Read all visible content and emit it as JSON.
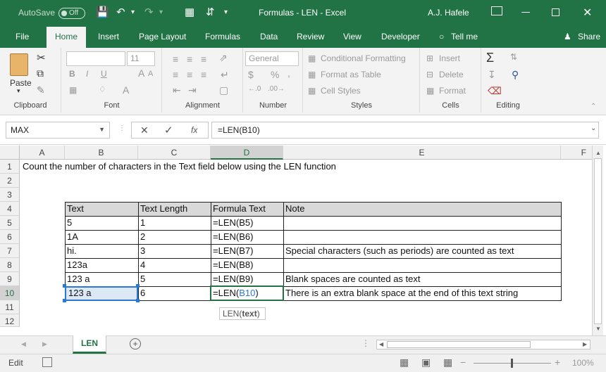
{
  "title_bar": {
    "autosave_label": "AutoSave",
    "autosave_state": "Off",
    "doc_title": "Formulas - LEN  -  Excel",
    "user": "A.J. Hafele"
  },
  "tabs": [
    "File",
    "Home",
    "Insert",
    "Page Layout",
    "Formulas",
    "Data",
    "Review",
    "View",
    "Developer",
    "Tell me",
    "Share"
  ],
  "ribbon": {
    "clipboard": {
      "paste": "Paste",
      "label": "Clipboard"
    },
    "font": {
      "size": "11",
      "bold": "B",
      "italic": "I",
      "underline": "U",
      "label": "Font"
    },
    "alignment": {
      "label": "Alignment"
    },
    "number": {
      "format": "General",
      "currency": "$",
      "percent": "%",
      "comma": ",",
      "label": "Number"
    },
    "styles": {
      "conditional": "Conditional Formatting",
      "table": "Format as Table",
      "cell": "Cell Styles",
      "label": "Styles"
    },
    "cells": {
      "insert": "Insert",
      "delete": "Delete",
      "format": "Format",
      "label": "Cells"
    },
    "editing": {
      "label": "Editing"
    }
  },
  "formula_bar": {
    "name_box": "MAX",
    "fx": "fx",
    "formula": "=LEN(B10)"
  },
  "columns": [
    "A",
    "B",
    "C",
    "D",
    "E",
    "F"
  ],
  "rows": [
    "1",
    "2",
    "3",
    "4",
    "5",
    "6",
    "7",
    "8",
    "9",
    "10",
    "11",
    "12"
  ],
  "cells": {
    "a1": "Count the number of characters in the Text field below using the LEN function",
    "headers": [
      "Text",
      "Text Length",
      "Formula Text",
      "Note"
    ],
    "table": [
      [
        "5",
        "1",
        "=LEN(B5)",
        ""
      ],
      [
        "1A",
        "2",
        "=LEN(B6)",
        ""
      ],
      [
        "hi.",
        "3",
        "=LEN(B7)",
        "Special characters (such as periods) are counted as text"
      ],
      [
        "123a",
        "4",
        "=LEN(B8)",
        ""
      ],
      [
        "123 a",
        "5",
        "=LEN(B9)",
        "Blank spaces are counted as text"
      ],
      [
        "123 a",
        "6",
        "=LEN(",
        "There is an extra blank space at the end of this text string"
      ]
    ],
    "edit_ref": "B10",
    "edit_close": ")"
  },
  "tooltip": {
    "fn": "LEN(",
    "arg": "text",
    ")": ")"
  },
  "tooltip_text": "LEN(text)",
  "sheet_tab": "LEN",
  "status": {
    "mode": "Edit",
    "zoom": "100%"
  }
}
